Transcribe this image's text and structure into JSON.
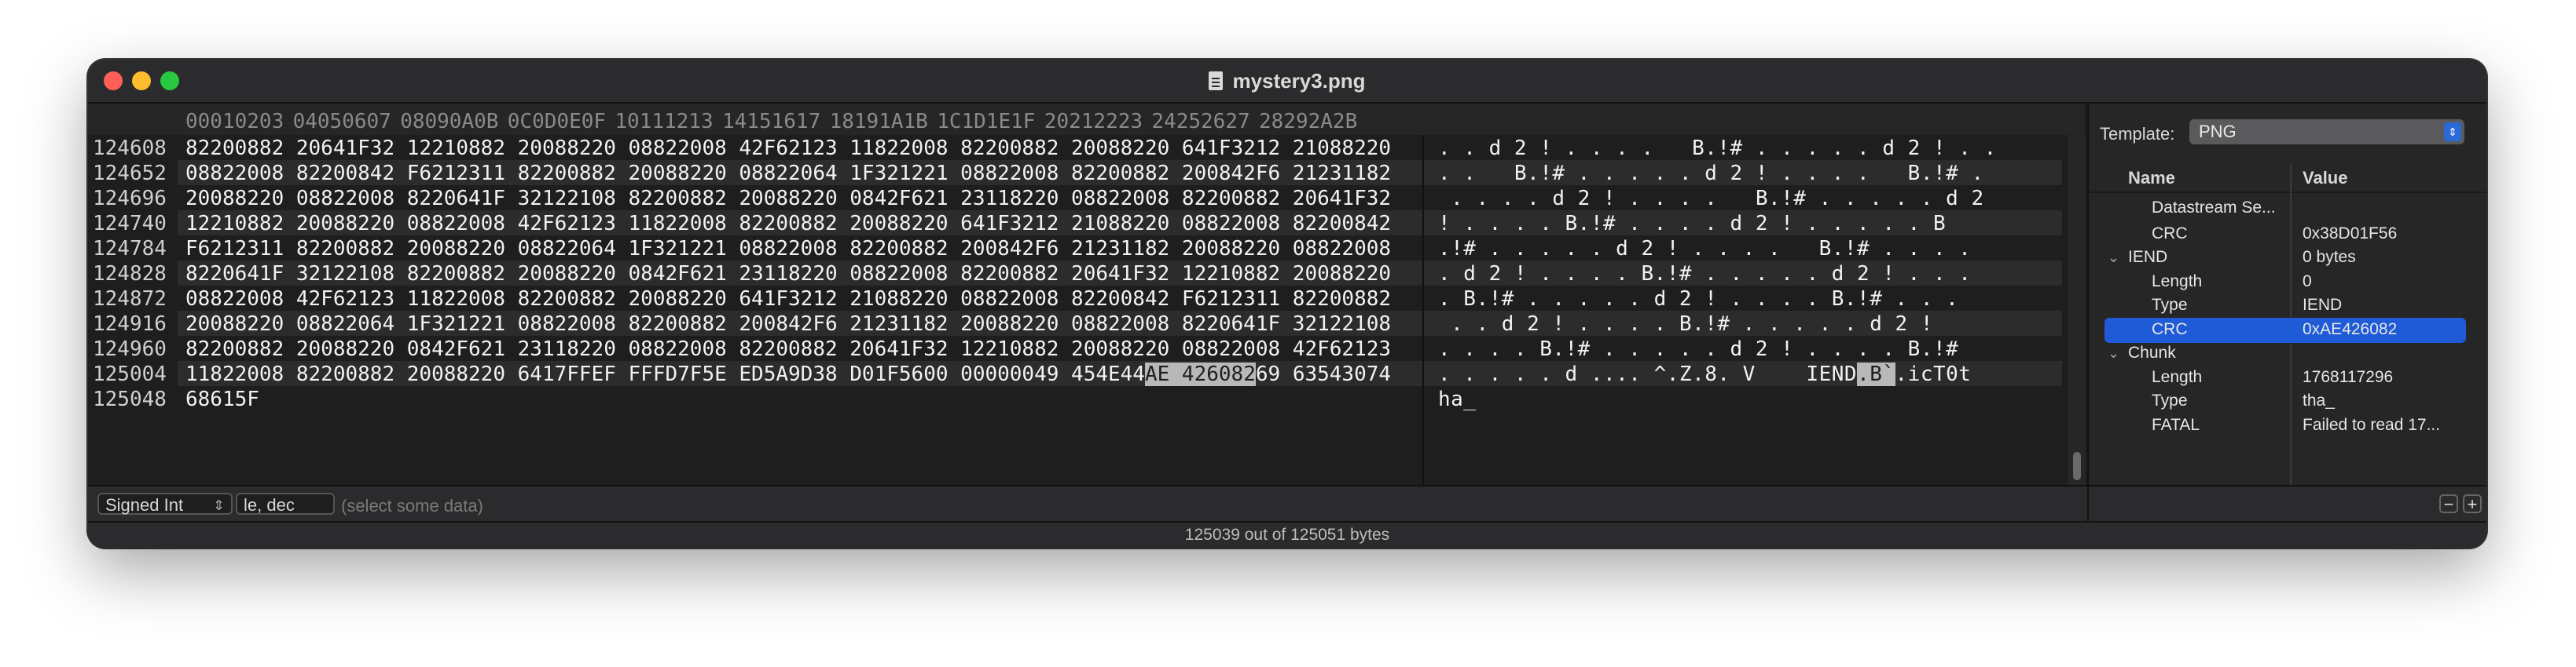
{
  "window": {
    "title": "mystery3.png",
    "icon": "document-icon"
  },
  "hex_header": [
    "00010203",
    "04050607",
    "08090A0B",
    "0C0D0E0F",
    "10111213",
    "14151617",
    "18191A1B",
    "1C1D1E1F",
    "20212223",
    "24252627",
    "28292A2B"
  ],
  "rows": [
    {
      "offset": "124608",
      "hex": "82200882 20641F32 12210882 20088220 08822008 42F62123 11822008 82200882 20088220 641F3212 21088220",
      "ascii": ". . d 2 ! . . . .   B.!# . . . . . d 2 ! . ."
    },
    {
      "offset": "124652",
      "hex": "08822008 82200842 F6212311 82200882 20088220 08822064 1F321221 08822008 82200882 200842F6 21231182",
      "ascii": ". .   B.!# . . . . . d 2 ! . . . .   B.!# ."
    },
    {
      "offset": "124696",
      "hex": "20088220 08822008 8220641F 32122108 82200882 20088220 0842F621 23118220 08822008 82200882 20641F32",
      "ascii": " . . . . d 2 ! . . . .   B.!# . . . . . d 2"
    },
    {
      "offset": "124740",
      "hex": "12210882 20088220 08822008 42F62123 11822008 82200882 20088220 641F3212 21088220 08822008 82200842",
      "ascii": "! . . . . B.!# . . . . d 2 ! . . . . . B"
    },
    {
      "offset": "124784",
      "hex": "F6212311 82200882 20088220 08822064 1F321221 08822008 82200882 200842F6 21231182 20088220 08822008",
      "ascii": ".!# . . . . . d 2 ! . . . .   B.!# . . . ."
    },
    {
      "offset": "124828",
      "hex": "8220641F 32122108 82200882 20088220 0842F621 23118220 08822008 82200882 20641F32 12210882 20088220",
      "ascii": ". d 2 ! . . . . B.!# . . . . . d 2 ! . . ."
    },
    {
      "offset": "124872",
      "hex": "08822008 42F62123 11822008 82200882 20088220 641F3212 21088220 08822008 82200842 F6212311 82200882",
      "ascii": ". B.!# . . . . . d 2 ! . . . . B.!# . . ."
    },
    {
      "offset": "124916",
      "hex": "20088220 08822064 1F321221 08822008 82200882 200842F6 21231182 20088220 08822008 8220641F 32122108",
      "ascii": " . . d 2 ! . . . . B.!# . . . . . d 2 !"
    },
    {
      "offset": "124960",
      "hex": "82200882 20088220 0842F621 23118220 08822008 82200882 20641F32 12210882 20088220 08822008 42F62123",
      "ascii": ". . . . B.!# . . . . . d 2 ! . . . . B.!#"
    },
    {
      "offset": "125004",
      "hex_pre": "11822008 82200882 20088220 6417FFEF FFFD7F5E ED5A9D38 D01F5600 00000049 454E44",
      "hex_sel": "AE 426082",
      "hex_post": "69 63543074",
      "ascii_pre": ". . . . . d .... ^.Z.8. V    IEND",
      "ascii_sel": ".B`",
      "ascii_post": ".icT0t"
    },
    {
      "offset": "125048",
      "hex": "68615F",
      "ascii": "ha_"
    }
  ],
  "bottom_bar": {
    "type_select": "Signed Int",
    "endian_select": "le, dec",
    "hint": "(select some data)"
  },
  "status": "125039 out of 125051 bytes",
  "sidebar": {
    "template_label": "Template:",
    "template_value": "PNG",
    "col_name": "Name",
    "col_value": "Value",
    "tree": [
      {
        "name": "Datastream Se...",
        "value": "",
        "indent": 2,
        "disclosure": "",
        "partial": true
      },
      {
        "name": "CRC",
        "value": "0x38D01F56",
        "indent": 2,
        "disclosure": ""
      },
      {
        "name": "IEND",
        "value": "0 bytes",
        "indent": 1,
        "disclosure": "⌄"
      },
      {
        "name": "Length",
        "value": "0",
        "indent": 2,
        "disclosure": ""
      },
      {
        "name": "Type",
        "value": "IEND",
        "indent": 2,
        "disclosure": ""
      },
      {
        "name": "CRC",
        "value": "0xAE426082",
        "indent": 2,
        "disclosure": "",
        "selected": true
      },
      {
        "name": "Chunk",
        "value": "",
        "indent": 1,
        "disclosure": "⌄"
      },
      {
        "name": "Length",
        "value": "1768117296",
        "indent": 2,
        "disclosure": ""
      },
      {
        "name": "Type",
        "value": "tha_",
        "indent": 2,
        "disclosure": ""
      },
      {
        "name": "FATAL",
        "value": "Failed to read 17...",
        "indent": 2,
        "disclosure": ""
      }
    ],
    "minus": "−",
    "plus": "+"
  }
}
